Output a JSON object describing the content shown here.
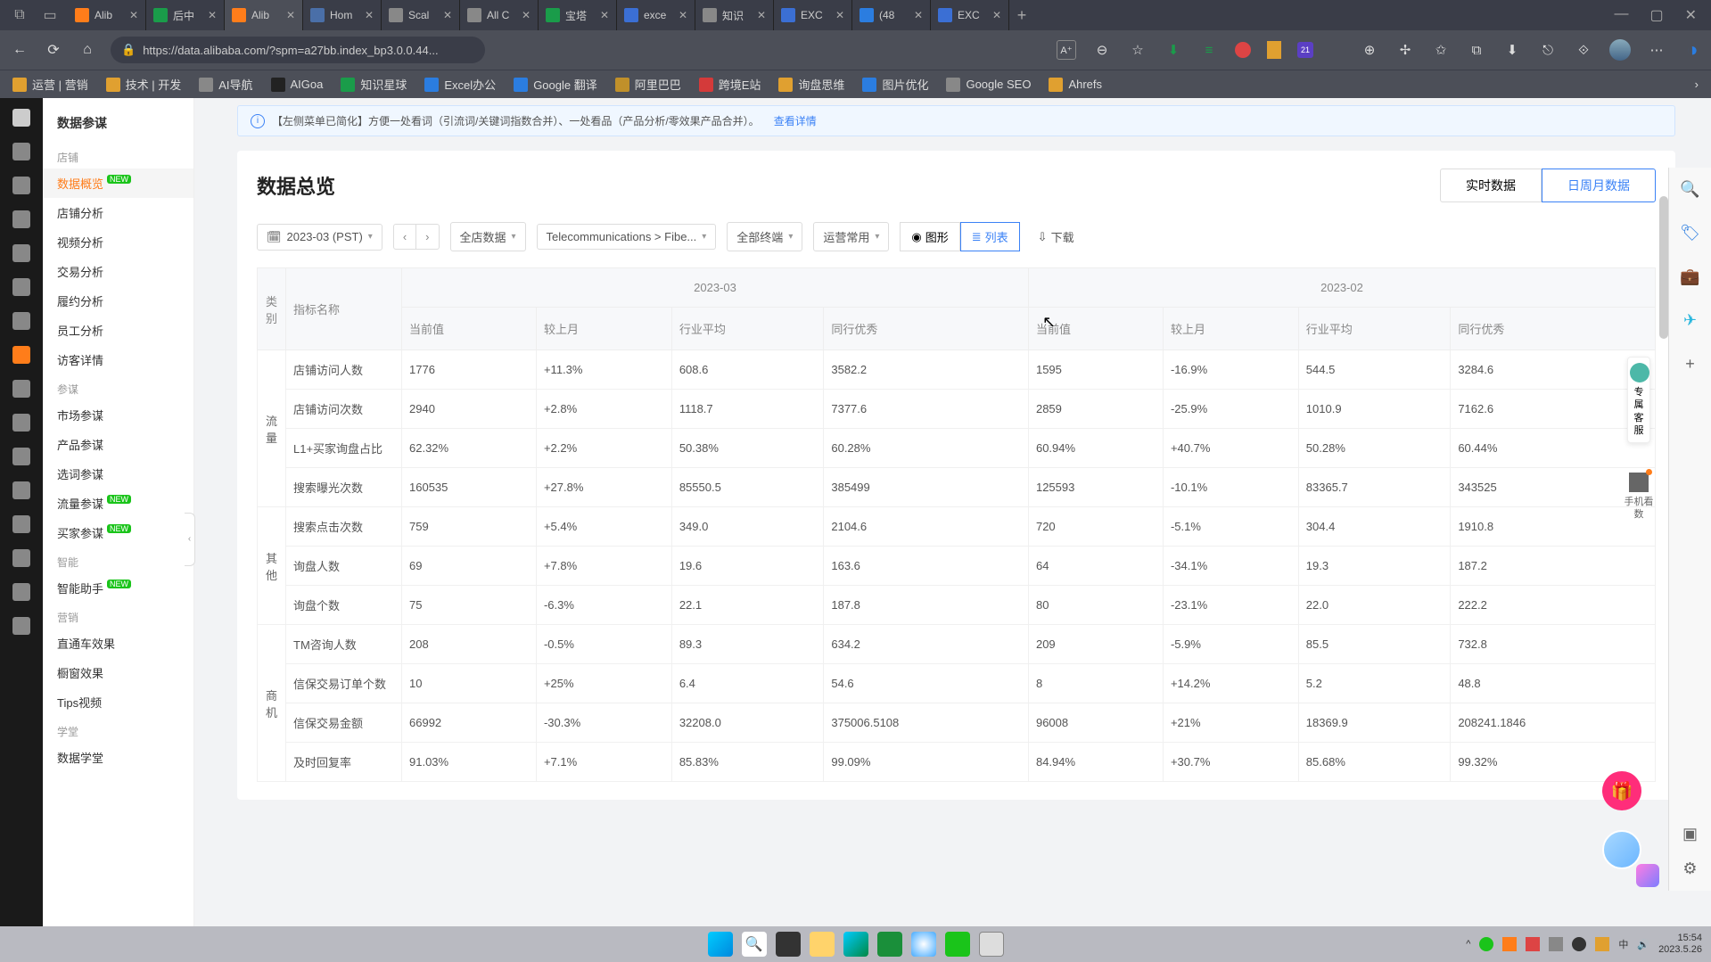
{
  "browser": {
    "tabs": [
      {
        "label": "Alib",
        "color": "#ff7d1a"
      },
      {
        "label": "后中",
        "color": "#1a9c4a"
      },
      {
        "label": "Alib",
        "color": "#ff7d1a",
        "active": true
      },
      {
        "label": "Hom",
        "color": "#4a6fa8"
      },
      {
        "label": "Scal",
        "color": "#888"
      },
      {
        "label": "All C",
        "color": "#888"
      },
      {
        "label": "宝塔",
        "color": "#1a9c4a"
      },
      {
        "label": "exce",
        "color": "#3b6fd4"
      },
      {
        "label": "知识",
        "color": "#888"
      },
      {
        "label": "EXC",
        "color": "#3b6fd4"
      },
      {
        "label": "(48",
        "color": "#2b7de0"
      },
      {
        "label": "EXC",
        "color": "#3b6fd4"
      }
    ],
    "url": "https://data.alibaba.com/?spm=a27bb.index_bp3.0.0.44...",
    "bookmarks": [
      {
        "label": "运营 | 营销",
        "color": "#e0a030"
      },
      {
        "label": "技术 | 开发",
        "color": "#e0a030"
      },
      {
        "label": "AI导航",
        "color": "#888"
      },
      {
        "label": "AIGoa",
        "color": "#222"
      },
      {
        "label": "知识星球",
        "color": "#1a9c4a"
      },
      {
        "label": "Excel办公",
        "color": "#2b7de0"
      },
      {
        "label": "Google 翻译",
        "color": "#2b7de0"
      },
      {
        "label": "阿里巴巴",
        "color": "#c0902a"
      },
      {
        "label": "跨境E站",
        "color": "#d43a3a"
      },
      {
        "label": "询盘思维",
        "color": "#e0a030"
      },
      {
        "label": "图片优化",
        "color": "#2b7de0"
      },
      {
        "label": "Google SEO",
        "color": "#888"
      },
      {
        "label": "Ahrefs",
        "color": "#e0a030"
      }
    ]
  },
  "sidebar": {
    "title": "数据参谋",
    "groups": [
      {
        "label": "店铺",
        "items": [
          {
            "label": "数据概览",
            "badge": "NEW",
            "active": true
          },
          {
            "label": "店铺分析"
          },
          {
            "label": "视频分析"
          },
          {
            "label": "交易分析"
          },
          {
            "label": "履约分析"
          },
          {
            "label": "员工分析"
          },
          {
            "label": "访客详情"
          }
        ]
      },
      {
        "label": "参谋",
        "items": [
          {
            "label": "市场参谋"
          },
          {
            "label": "产品参谋"
          },
          {
            "label": "选词参谋"
          },
          {
            "label": "流量参谋",
            "badge": "NEW"
          },
          {
            "label": "买家参谋",
            "badge": "NEW"
          }
        ]
      },
      {
        "label": "智能",
        "items": [
          {
            "label": "智能助手",
            "badge": "NEW"
          }
        ]
      },
      {
        "label": "营销",
        "items": [
          {
            "label": "直通车效果"
          },
          {
            "label": "橱窗效果"
          },
          {
            "label": "Tips视频"
          }
        ]
      },
      {
        "label": "学堂",
        "items": [
          {
            "label": "数据学堂"
          }
        ]
      }
    ]
  },
  "notice": {
    "text": "【左侧菜单已简化】方便一处看词（引流词/关键词指数合并）、一处看品（产品分析/零效果产品合并）。",
    "link": "查看详情"
  },
  "page": {
    "title": "数据总览",
    "tab_realtime": "实时数据",
    "tab_period": "日周月数据",
    "date": "2023-03 (PST)",
    "filter_all": "全店数据",
    "filter_cat": "Telecommunications > Fibe...",
    "filter_term": "全部终端",
    "filter_op": "运营常用",
    "view_chart": "图形",
    "view_list": "列表",
    "download": "下载"
  },
  "table": {
    "headers": {
      "cat": "类别",
      "metric": "指标名称",
      "month1": "2023-03",
      "month2": "2023-02",
      "cols": [
        "当前值",
        "较上月",
        "行业平均",
        "同行优秀"
      ]
    },
    "groups": [
      {
        "cat": "流量",
        "rows": [
          {
            "name": "店铺访问人数",
            "m1": [
              "1776",
              "+11.3%",
              "608.6",
              "3582.2"
            ],
            "m2": [
              "1595",
              "-16.9%",
              "544.5",
              "3284.6"
            ]
          },
          {
            "name": "店铺访问次数",
            "m1": [
              "2940",
              "+2.8%",
              "1118.7",
              "7377.6"
            ],
            "m2": [
              "2859",
              "-25.9%",
              "1010.9",
              "7162.6"
            ]
          },
          {
            "name": "L1+买家询盘占比",
            "m1": [
              "62.32%",
              "+2.2%",
              "50.38%",
              "60.28%"
            ],
            "m2": [
              "60.94%",
              "+40.7%",
              "50.28%",
              "60.44%"
            ]
          },
          {
            "name": "搜索曝光次数",
            "m1": [
              "160535",
              "+27.8%",
              "85550.5",
              "385499"
            ],
            "m2": [
              "125593",
              "-10.1%",
              "83365.7",
              "343525"
            ]
          }
        ]
      },
      {
        "cat": "其他",
        "rows": [
          {
            "name": "搜索点击次数",
            "m1": [
              "759",
              "+5.4%",
              "349.0",
              "2104.6"
            ],
            "m2": [
              "720",
              "-5.1%",
              "304.4",
              "1910.8"
            ]
          },
          {
            "name": "询盘人数",
            "m1": [
              "69",
              "+7.8%",
              "19.6",
              "163.6"
            ],
            "m2": [
              "64",
              "-34.1%",
              "19.3",
              "187.2"
            ]
          },
          {
            "name": "询盘个数",
            "m1": [
              "75",
              "-6.3%",
              "22.1",
              "187.8"
            ],
            "m2": [
              "80",
              "-23.1%",
              "22.0",
              "222.2"
            ]
          }
        ]
      },
      {
        "cat": "商机",
        "rows": [
          {
            "name": "TM咨询人数",
            "m1": [
              "208",
              "-0.5%",
              "89.3",
              "634.2"
            ],
            "m2": [
              "209",
              "-5.9%",
              "85.5",
              "732.8"
            ]
          },
          {
            "name": "信保交易订单个数",
            "m1": [
              "10",
              "+25%",
              "6.4",
              "54.6"
            ],
            "m2": [
              "8",
              "+14.2%",
              "5.2",
              "48.8"
            ]
          },
          {
            "name": "信保交易金额",
            "m1": [
              "66992",
              "-30.3%",
              "32208.0",
              "375006.5108"
            ],
            "m2": [
              "96008",
              "+21%",
              "18369.9",
              "208241.1846"
            ]
          },
          {
            "name": "及时回复率",
            "m1": [
              "91.03%",
              "+7.1%",
              "85.83%",
              "99.09%"
            ],
            "m2": [
              "84.94%",
              "+30.7%",
              "85.68%",
              "99.32%"
            ]
          }
        ]
      }
    ]
  },
  "float": {
    "cs": "专属客服",
    "qr": "手机看数"
  },
  "clock": {
    "time": "15:54",
    "date": "2023.5.26"
  }
}
